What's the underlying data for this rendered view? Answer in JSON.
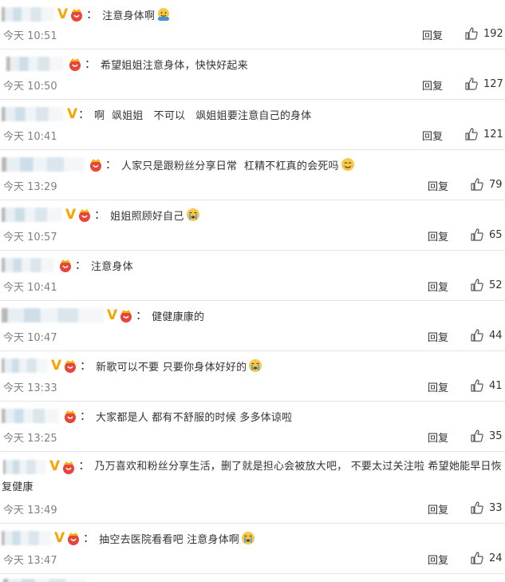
{
  "reply_label": "回复",
  "colon": "：",
  "colors": {
    "v_badge": "#f7a400",
    "crown": "#e8443a",
    "text": "#333333",
    "meta": "#808080",
    "divider": "#e6e6e6"
  },
  "comments": [
    {
      "text": "注意身体啊",
      "emoji": "hug-emoji",
      "time": "今天 10:51",
      "likes": "192"
    },
    {
      "text": "希望姐姐注意身体，快快好起来",
      "emoji": "",
      "time": "今天 10:50",
      "likes": "127"
    },
    {
      "text": "啊  飒姐姐   不可以   飒姐姐要注意自己的身体",
      "emoji": "",
      "time": "今天 10:41",
      "likes": "121"
    },
    {
      "text": "人家只是跟粉丝分享日常  杠精不杠真的会死吗",
      "emoji": "smile-emoji",
      "time": "今天 13:29",
      "likes": "79"
    },
    {
      "text": "姐姐照顾好自己",
      "emoji": "cry-emoji",
      "time": "今天 10:57",
      "likes": "65"
    },
    {
      "text": "注意身体",
      "emoji": "",
      "time": "今天 10:41",
      "likes": "52"
    },
    {
      "text": "健健康康的",
      "emoji": "",
      "time": "今天 10:47",
      "likes": "44"
    },
    {
      "text": "新歌可以不要 只要你身体好好的",
      "emoji": "cry-emoji",
      "time": "今天 13:33",
      "likes": "41"
    },
    {
      "text": "大家都是人 都有不舒服的时候 多多体谅啦",
      "emoji": "",
      "time": "今天 13:25",
      "likes": "35"
    },
    {
      "text": "乃万喜欢和粉丝分享生活，删了就是担心会被放大吧， 不要太过关注啦 希望她能早日恢复健康",
      "emoji": "",
      "time": "今天 13:49",
      "likes": "33"
    },
    {
      "text": "抽空去医院看看吧 注意身体啊",
      "emoji": "cry-emoji",
      "time": "今天 13:47",
      "likes": "24"
    }
  ]
}
